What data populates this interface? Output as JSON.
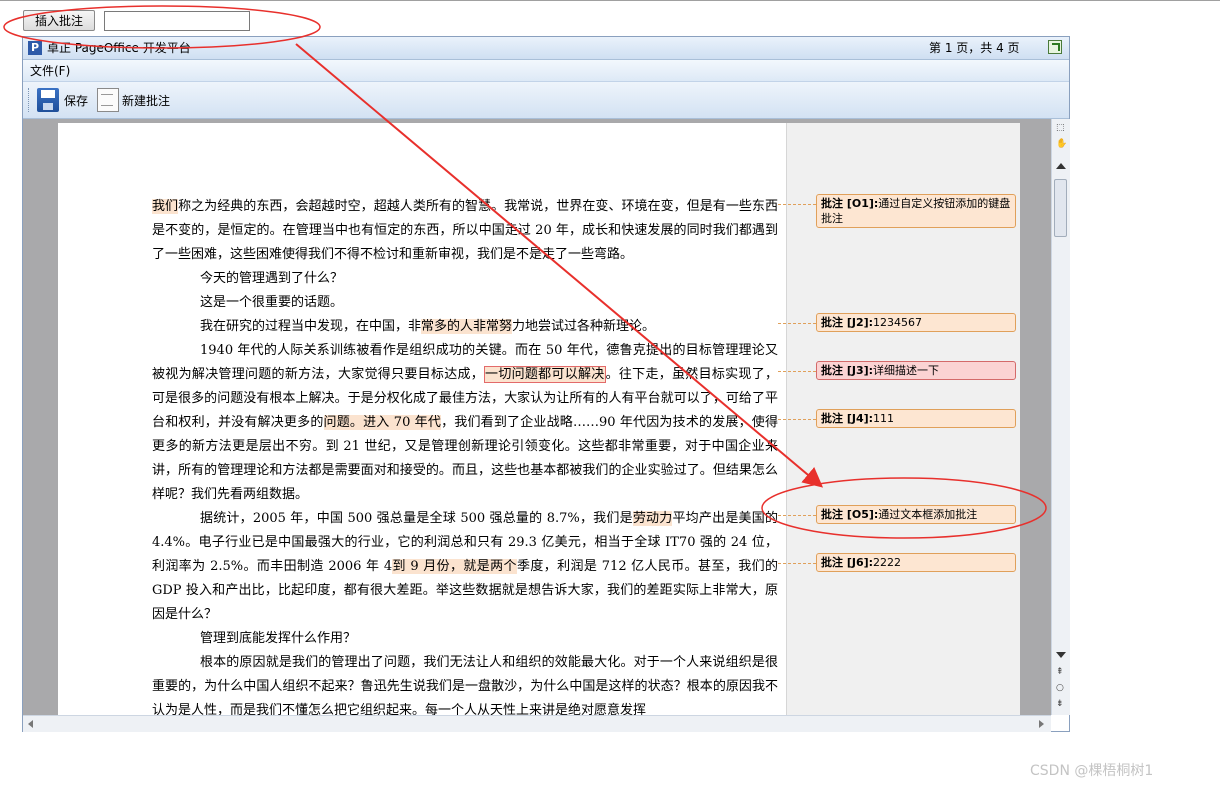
{
  "top": {
    "insert_button": "插入批注",
    "insert_input_value": ""
  },
  "window": {
    "title": "卓正 PageOffice 开发平台",
    "page_info": "第 1 页，共 4 页",
    "menu_file": "文件(F)",
    "toolbar": {
      "save_label": "保存",
      "new_comment_label": "新建批注"
    }
  },
  "document": {
    "paragraphs": [
      {
        "indent": false,
        "segments": [
          {
            "t": "我们",
            "hl": true
          },
          {
            "t": "称之为经典的东西，会超越时空，超越人类所有的智慧。我常说，世界在变、环境在变，但是有一些东西是不变的，是恒定的。在管理当中也有恒定的东西，所以中国走过 20 年，成长和快速发展的同时我们都遇到了一些困难，这些困难使得我们不得不检讨和重新审视，我们是不是走了一些弯路。"
          }
        ]
      },
      {
        "indent": true,
        "segments": [
          {
            "t": "今天的管理遇到了什么？"
          }
        ]
      },
      {
        "indent": true,
        "segments": [
          {
            "t": "这是一个很重要的话题。"
          }
        ]
      },
      {
        "indent": true,
        "segments": [
          {
            "t": "我在研究的过程当中发现，在中国，非"
          },
          {
            "t": "常多的人非常努",
            "hl": true
          },
          {
            "t": "力地尝试过各种新理论。"
          }
        ]
      },
      {
        "indent": true,
        "segments": [
          {
            "t": "1940 年代的人际关系训练被看作是组织成功的关键。而在 50 年代，德鲁克提出的目标管理理论又被视为解决管理问题的新方法，大家觉得只要目标达成，"
          },
          {
            "t": "一切问题都可以解决",
            "hl": true,
            "red": true
          },
          {
            "t": "。往下走，虽然目标实现了，可是很多的问题没有根本上解决。于是分权化成了最佳方法，大家认为让所有的人有平台就可以了，可给了平台和权利，并没有解决更多的"
          },
          {
            "t": "问题。进入 70 年代",
            "hl": true
          },
          {
            "t": "，我们看到了企业战略……90 年代因为技术的发展，使得更多的新方法更是层出不穷。到 21 世纪，又是管理创新理论引领变化。这些都非常重要，对于中国企业来讲，所有的管理理论和方法都是需要面对和接受的。而且，这些也基本都被我们的企业实验过了。但结果怎么样呢？我们先看两组数据。"
          }
        ]
      },
      {
        "indent": true,
        "segments": [
          {
            "t": "据统计，2005 年，中国 500 强总量是全球 500 强总量的 8.7%，我们是"
          },
          {
            "t": "劳动力",
            "hl": true
          },
          {
            "t": "平均产出是美国的 4.4%。电子行业已是中国最强大的行业，它的利润总和只有 29.3 亿美元，相当于全球 IT70 强的 24 位，利润率为 2.5%。而丰田制造 2006 年 4"
          },
          {
            "t": "到 9 月份，就是两个",
            "hl": true
          },
          {
            "t": "季度，利润是 712 亿人民币。甚至，我们的 GDP 投入和产出比，比起印度，都有很大差距。举这些数据就是想告诉大家，我们的差距实际上非常大，原因是什么？"
          }
        ]
      },
      {
        "indent": true,
        "segments": [
          {
            "t": "管理到底能发挥什么作用？"
          }
        ]
      },
      {
        "indent": true,
        "segments": [
          {
            "t": "根本的原因就是我们的管理出了问题，我们无法让人和组织的效能最大化。对于一个人来说组织是很重要的，为什么中国人组织不起来？鲁迅先生说我们是一盘散沙，为什么中国是这样的状态？根本的原因我不认为是人性，而是我们不懂怎么把它组织起来。每一个人从天性上来讲是绝对愿意发挥"
          }
        ]
      }
    ],
    "comments": [
      {
        "label": "批注 [O1]:",
        "text": "通过自定义按钮添加的键盘批注",
        "red": false
      },
      {
        "label": "批注 [J2]:",
        "text": "1234567",
        "red": false
      },
      {
        "label": "批注 [J3]:",
        "text": "详细描述一下",
        "red": true
      },
      {
        "label": "批注 [J4]:",
        "text": "111",
        "red": false
      },
      {
        "label": "批注 [O5]:",
        "text": "通过文本框添加批注",
        "red": false
      },
      {
        "label": "批注 [J6]:",
        "text": "2222",
        "red": false
      }
    ]
  },
  "watermark": "CSDN @棵梧桐树1",
  "colors": {
    "annotation_red": "#e8302c",
    "comment_fill": "#fde6d2",
    "comment_border": "#e0a05a"
  }
}
